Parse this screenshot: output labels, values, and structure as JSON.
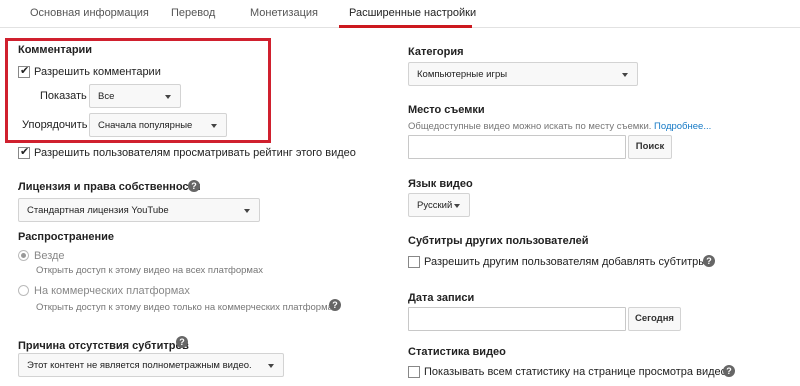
{
  "tabs": [
    {
      "label": "Основная информация"
    },
    {
      "label": "Перевод"
    },
    {
      "label": "Монетизация"
    },
    {
      "label": "Расширенные настройки"
    }
  ],
  "comments": {
    "title": "Комментарии",
    "allow_label": "Разрешить комментарии",
    "show_label": "Показать",
    "show_value": "Все",
    "sort_label": "Упорядочить",
    "sort_value": "Сначала популярные"
  },
  "rating": {
    "label": "Разрешить пользователям просматривать рейтинг этого видео"
  },
  "license": {
    "title": "Лицензия и права собственности",
    "value": "Стандартная лицензия YouTube"
  },
  "distribution": {
    "title": "Распространение",
    "everywhere_label": "Везде",
    "everywhere_hint": "Открыть доступ к этому видео на всех платформах",
    "commercial_label": "На коммерческих платформах",
    "commercial_hint": "Открыть доступ к этому видео только на коммерческих платформах"
  },
  "subtitles_reason": {
    "title": "Причина отсутствия субтитров",
    "value": "Этот контент не является полнометражным видео."
  },
  "category": {
    "title": "Категория",
    "value": "Компьютерные игры"
  },
  "location": {
    "title": "Место съемки",
    "hint": "Общедоступные видео можно искать по месту съемки.",
    "link": "Подробнее...",
    "search_button": "Поиск"
  },
  "video_language": {
    "title": "Язык видео",
    "value": "Русский"
  },
  "community_subtitles": {
    "title": "Субтитры других пользователей",
    "label": "Разрешить другим пользователям добавлять субтитры"
  },
  "record_date": {
    "title": "Дата записи",
    "today_button": "Сегодня"
  },
  "stats": {
    "title": "Статистика видео",
    "label": "Показывать всем статистику на странице просмотра видео"
  },
  "help_icon_glyph": "?",
  "colors": {
    "accent": "#cc181e",
    "highlight": "#d0202e",
    "link": "#167ac6"
  }
}
